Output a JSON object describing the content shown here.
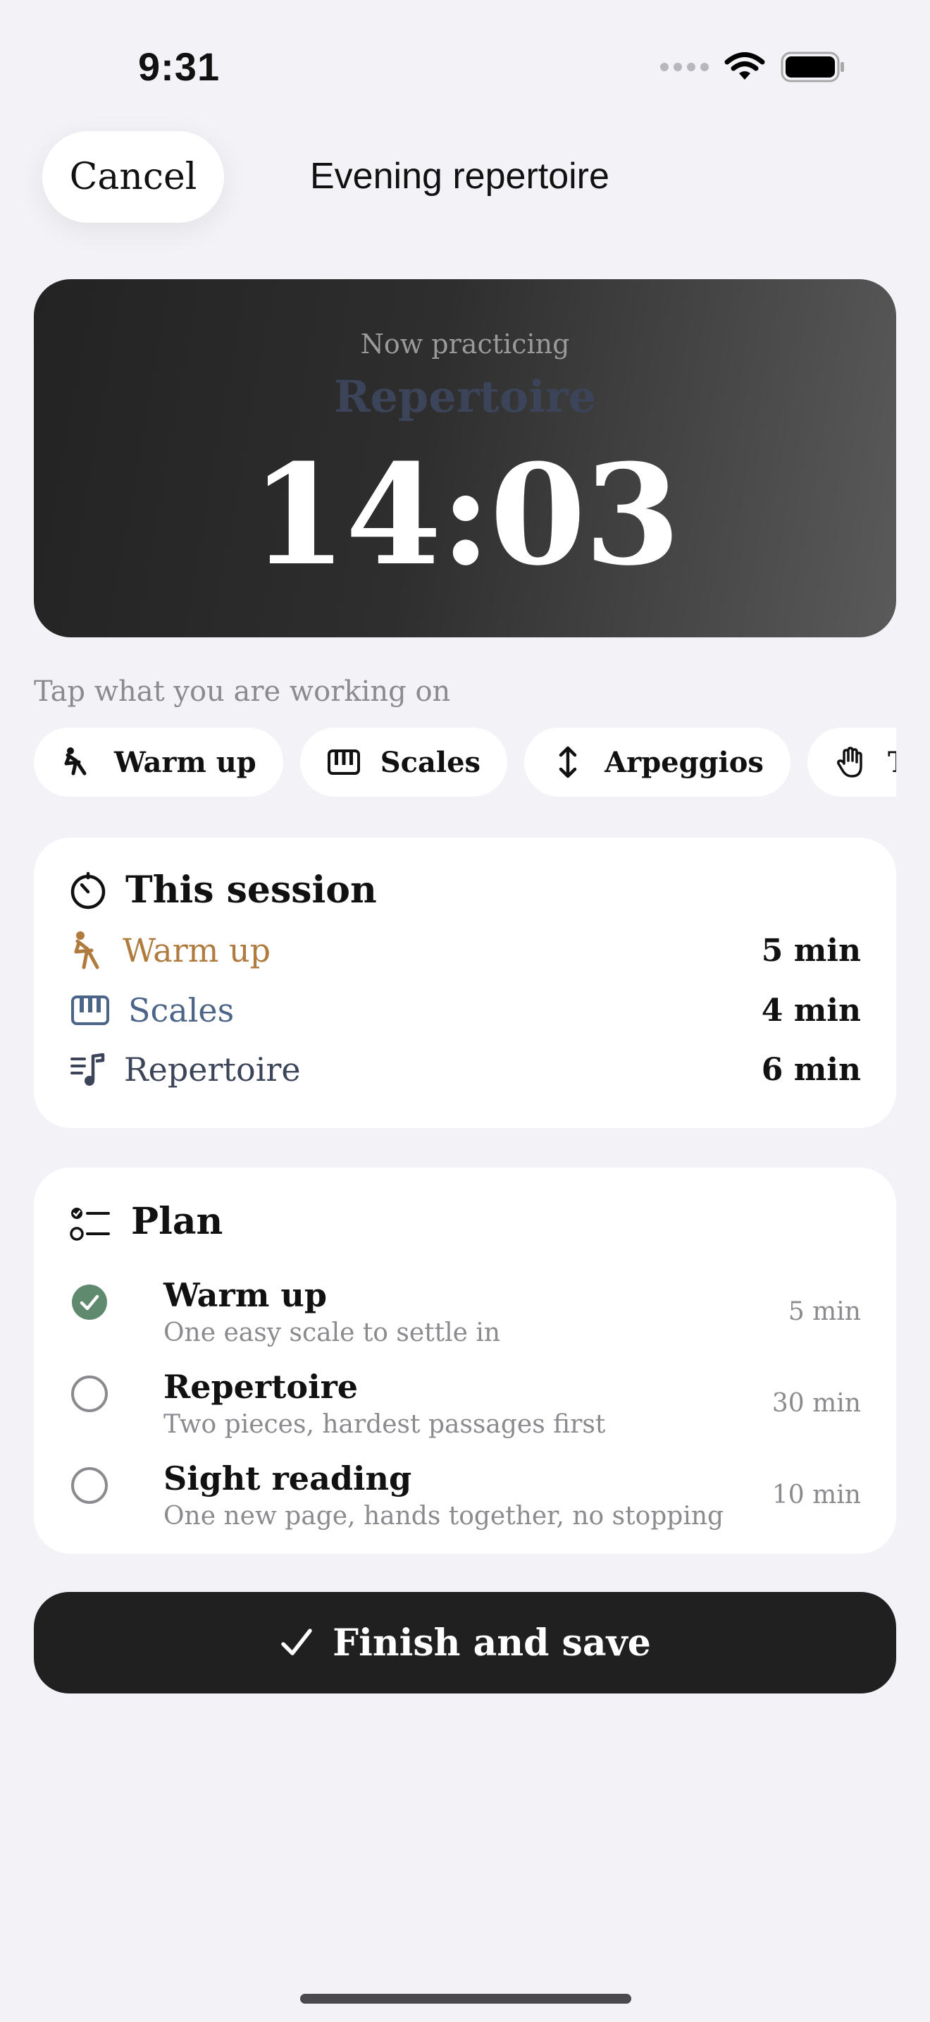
{
  "status_bar": {
    "time": "9:31"
  },
  "header": {
    "cancel_label": "Cancel",
    "title": "Evening repertoire"
  },
  "timer_card": {
    "label": "Now practicing",
    "activity": "Repertoire",
    "time": "14:03"
  },
  "hint": "Tap what you are working on",
  "chips": [
    {
      "label": "Warm up",
      "icon": "stretch-icon"
    },
    {
      "label": "Scales",
      "icon": "piano-keys-icon"
    },
    {
      "label": "Arpeggios",
      "icon": "up-down-arrow-icon"
    },
    {
      "label": "Techni",
      "icon": "hand-icon"
    }
  ],
  "session": {
    "title": "This session",
    "rows": [
      {
        "label": "Warm up",
        "value": "5 min",
        "color": "#b07b3e"
      },
      {
        "label": "Scales",
        "value": "4 min",
        "color": "#4b6487"
      },
      {
        "label": "Repertoire",
        "value": "6 min",
        "color": "#3b4459"
      }
    ]
  },
  "plan": {
    "title": "Plan",
    "items": [
      {
        "title": "Warm up",
        "subtitle": "One easy scale to settle in",
        "duration": "5 min",
        "done": true
      },
      {
        "title": "Repertoire",
        "subtitle": "Two pieces, hardest passages first",
        "duration": "30 min",
        "done": false
      },
      {
        "title": "Sight reading",
        "subtitle": "One new page, hands together, no stopping",
        "duration": "10 min",
        "done": false
      }
    ]
  },
  "finish_label": "Finish and save",
  "colors": {
    "done_green": "#5f8a6d",
    "warm_up": "#b07b3e",
    "scales": "#4b6487",
    "repertoire": "#3b4459"
  }
}
